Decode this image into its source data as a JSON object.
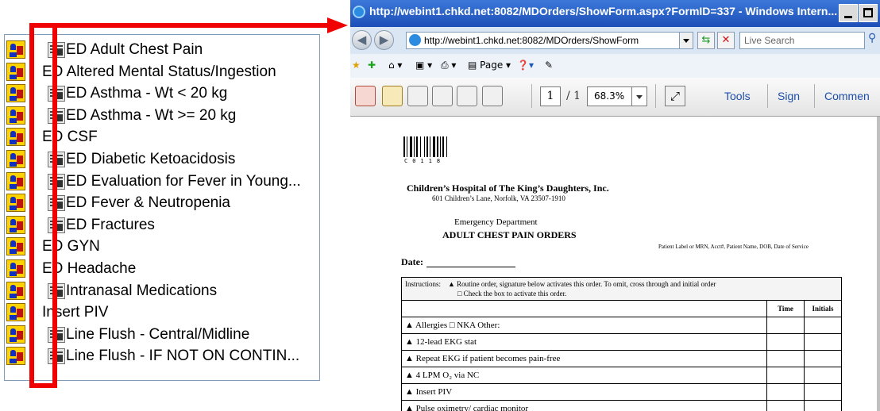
{
  "order_list": [
    {
      "icon": "order-set-icon",
      "form_icon": true,
      "label": "ED Adult Chest Pain"
    },
    {
      "icon": "order-set-icon",
      "form_icon": false,
      "label": "ED Altered Mental Status/Ingestion"
    },
    {
      "icon": "order-set-icon",
      "form_icon": true,
      "label": "ED Asthma - Wt < 20 kg"
    },
    {
      "icon": "order-set-icon",
      "form_icon": true,
      "label": "ED Asthma - Wt >= 20 kg"
    },
    {
      "icon": "order-set-icon",
      "form_icon": false,
      "label": "ED CSF"
    },
    {
      "icon": "order-set-icon",
      "form_icon": true,
      "label": "ED Diabetic Ketoacidosis"
    },
    {
      "icon": "order-set-icon",
      "form_icon": true,
      "label": "ED Evaluation for Fever in Young..."
    },
    {
      "icon": "order-set-icon",
      "form_icon": true,
      "label": "ED Fever & Neutropenia"
    },
    {
      "icon": "order-set-icon",
      "form_icon": true,
      "label": "ED Fractures"
    },
    {
      "icon": "order-set-icon",
      "form_icon": false,
      "label": "ED GYN"
    },
    {
      "icon": "order-set-icon",
      "form_icon": false,
      "label": "ED Headache"
    },
    {
      "icon": "order-set-icon",
      "form_icon": true,
      "label": "Intranasal Medications"
    },
    {
      "icon": "order-set-icon",
      "form_icon": false,
      "label": "Insert PIV"
    },
    {
      "icon": "order-set-icon",
      "form_icon": true,
      "label": "Line Flush - Central/Midline"
    },
    {
      "icon": "order-set-icon",
      "form_icon": true,
      "label": "Line Flush - IF NOT ON CONTIN..."
    }
  ],
  "colors": {
    "highlight": "#f00000",
    "titlebar": "#2a5fc8",
    "link": "#1f4ea8"
  },
  "browser": {
    "title": "http://webint1.chkd.net:8082/MDOrders/ShowForm.aspx?FormID=337 - Windows Intern...",
    "address": "http://webint1.chkd.net:8082/MDOrders/ShowForm",
    "search_placeholder": "Live Search",
    "command_bar": {
      "page": "Page"
    }
  },
  "pdf_toolbar": {
    "page_current": "1",
    "page_total": "/ 1",
    "zoom": "68.3%",
    "tools": "Tools",
    "sign": "Sign",
    "comment": "Commen"
  },
  "document": {
    "barcode_number": "C0118",
    "organization": "Children’s Hospital of The King’s Daughters, Inc.",
    "address": "601 Children’s Lane, Norfolk, VA 23507-1910",
    "department": "Emergency Department",
    "form_title": "ADULT CHEST PAIN ORDERS",
    "patient_label": "Patient Label or MRN, Acct#, Patient Name, DOB, Date of Service",
    "date_label": "Date:",
    "instructions_label": "Instructions:",
    "instructions_line1": "▲ Routine order, signature below activates this order.  To omit, cross through and initial order",
    "instructions_line2": "□ Check the box to activate this order.",
    "column_time": "Time",
    "column_initials": "Initials",
    "orders": [
      "▲ Allergies □ NKA    Other:",
      "▲ 12-lead EKG stat",
      "▲ Repeat EKG if patient becomes pain-free",
      "▲ 4 LPM O₂ via NC",
      "▲ Insert PIV",
      "▲ Pulse oximetry/ cardiac monitor"
    ]
  }
}
